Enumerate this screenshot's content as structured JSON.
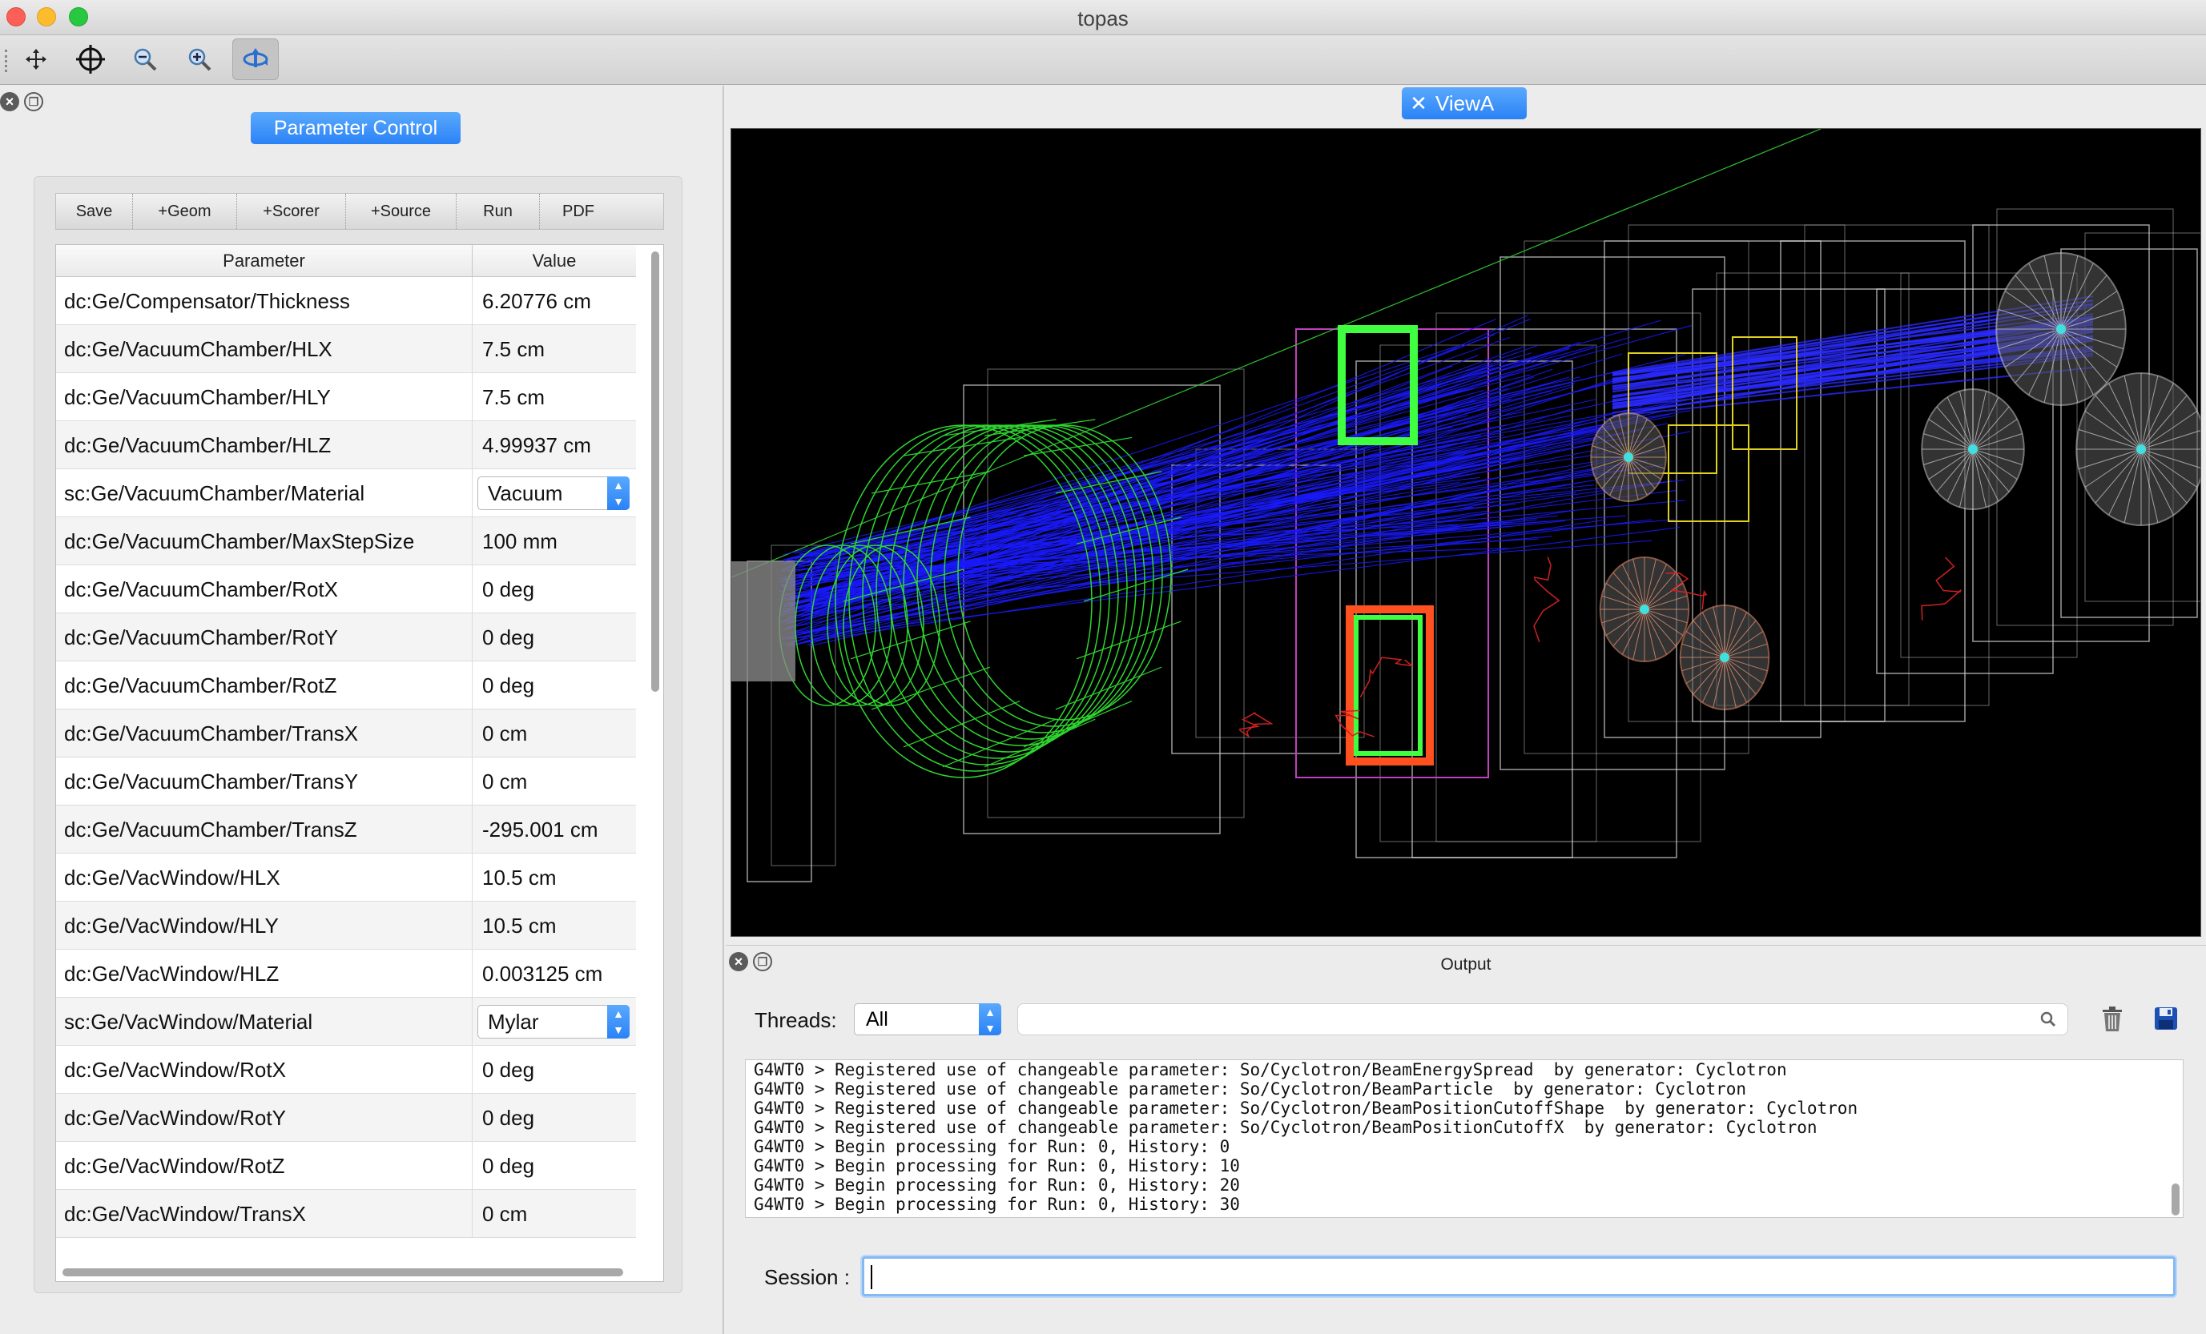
{
  "window": {
    "title": "topas"
  },
  "toolbar": {
    "tools": [
      {
        "name": "move-icon"
      },
      {
        "name": "pick-crosshair-icon"
      },
      {
        "name": "zoom-out-icon"
      },
      {
        "name": "zoom-in-icon"
      },
      {
        "name": "rotate-icon",
        "active": true
      }
    ]
  },
  "param_control": {
    "title": "Parameter Control",
    "buttons": [
      "Save",
      "+Geom",
      "+Scorer",
      "+Source",
      "Run",
      "PDF"
    ],
    "columns": {
      "parameter": "Parameter",
      "value": "Value"
    },
    "rows": [
      {
        "name": "dc:Ge/Compensator/Thickness",
        "value": "6.20776 cm"
      },
      {
        "name": "dc:Ge/VacuumChamber/HLX",
        "value": "7.5 cm"
      },
      {
        "name": "dc:Ge/VacuumChamber/HLY",
        "value": "7.5 cm"
      },
      {
        "name": "dc:Ge/VacuumChamber/HLZ",
        "value": "4.99937 cm"
      },
      {
        "name": "sc:Ge/VacuumChamber/Material",
        "value": "Vacuum",
        "combo": true
      },
      {
        "name": "dc:Ge/VacuumChamber/MaxStepSize",
        "value": "100 mm"
      },
      {
        "name": "dc:Ge/VacuumChamber/RotX",
        "value": "0 deg"
      },
      {
        "name": "dc:Ge/VacuumChamber/RotY",
        "value": "0 deg"
      },
      {
        "name": "dc:Ge/VacuumChamber/RotZ",
        "value": "0 deg"
      },
      {
        "name": "dc:Ge/VacuumChamber/TransX",
        "value": "0 cm"
      },
      {
        "name": "dc:Ge/VacuumChamber/TransY",
        "value": "0 cm"
      },
      {
        "name": "dc:Ge/VacuumChamber/TransZ",
        "value": "-295.001 cm"
      },
      {
        "name": "dc:Ge/VacWindow/HLX",
        "value": "10.5 cm"
      },
      {
        "name": "dc:Ge/VacWindow/HLY",
        "value": "10.5 cm"
      },
      {
        "name": "dc:Ge/VacWindow/HLZ",
        "value": "0.003125 cm"
      },
      {
        "name": "sc:Ge/VacWindow/Material",
        "value": "Mylar",
        "combo": true
      },
      {
        "name": "dc:Ge/VacWindow/RotX",
        "value": "0 deg"
      },
      {
        "name": "dc:Ge/VacWindow/RotY",
        "value": "0 deg"
      },
      {
        "name": "dc:Ge/VacWindow/RotZ",
        "value": "0 deg"
      },
      {
        "name": "dc:Ge/VacWindow/TransX",
        "value": "0 cm"
      }
    ]
  },
  "viewer": {
    "tab_label": "ViewA"
  },
  "output": {
    "title": "Output",
    "threads_label": "Threads:",
    "threads_value": "All",
    "filter_value": "",
    "log_lines": [
      "G4WT0 > Registered use of changeable parameter: So/Cyclotron/BeamEnergySpread  by generator: Cyclotron",
      "G4WT0 > Registered use of changeable parameter: So/Cyclotron/BeamParticle  by generator: Cyclotron",
      "G4WT0 > Registered use of changeable parameter: So/Cyclotron/BeamPositionCutoffShape  by generator: Cyclotron",
      "G4WT0 > Registered use of changeable parameter: So/Cyclotron/BeamPositionCutoffX  by generator: Cyclotron",
      "G4WT0 > Begin processing for Run: 0, History: 0",
      "G4WT0 > Begin processing for Run: 0, History: 10",
      "G4WT0 > Begin processing for Run: 0, History: 20",
      "G4WT0 > Begin processing for Run: 0, History: 30"
    ],
    "session_label": "Session :",
    "session_value": ""
  },
  "colors": {
    "accent": "#2a82f6",
    "viewport_bg": "#000000",
    "geometry_green": "#2fd62f",
    "beam_blue": "#1a1aff",
    "wire_gray": "#d0d0d0"
  }
}
